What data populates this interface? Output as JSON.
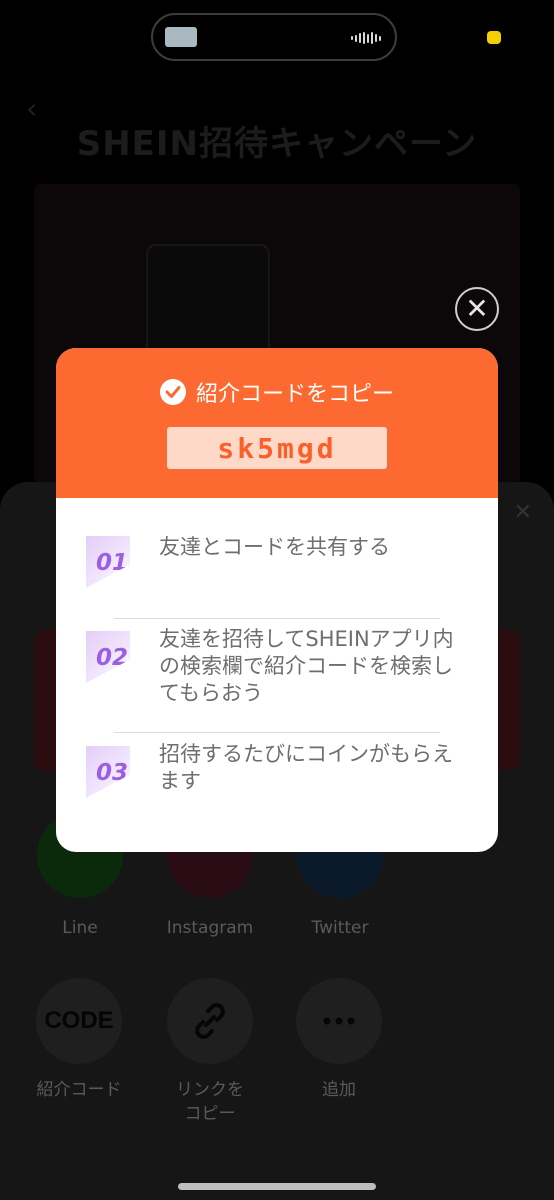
{
  "background": {
    "header": {
      "title": "SHEIN招待キャンペーン"
    },
    "sheet": {
      "share_apps": [
        {
          "label": "Line",
          "color": "#0b2a0b"
        },
        {
          "label": "Instagram",
          "color": "#2a0c14"
        },
        {
          "label": "Twitter",
          "color": "#0b1a2a"
        }
      ],
      "actions": [
        {
          "label": "紹介コード",
          "icon": "code-text-icon",
          "icon_text": "CODE"
        },
        {
          "label": "リンクをコピー",
          "icon": "link-icon"
        },
        {
          "label": "追加",
          "icon": "more-icon"
        }
      ]
    }
  },
  "modal": {
    "copied_label": "紹介コードをコピー",
    "code": "sk5mgd",
    "accent": "#fc6a32",
    "steps": [
      {
        "num": "01",
        "text": "友達とコードを共有する"
      },
      {
        "num": "02",
        "text": "友達を招待してSHEINアプリ内の検索欄で紹介コードを検索してもらおう"
      },
      {
        "num": "03",
        "text": "招待するたびにコインがもらえます"
      }
    ]
  }
}
